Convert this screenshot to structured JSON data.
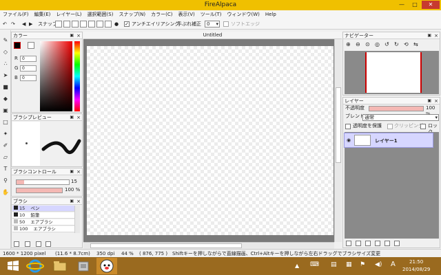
{
  "window": {
    "title": "FireAlpaca",
    "minimize_icon": "minimize-icon",
    "maximize_icon": "maximize-icon",
    "close_icon": "close-icon"
  },
  "menu": [
    "ファイル(F)",
    "編集(E)",
    "レイヤー(L)",
    "選択範囲(S)",
    "スナップ(N)",
    "カラー(C)",
    "表示(V)",
    "ツール(T)",
    "ウィンドウ(W)",
    "Help"
  ],
  "toolbar": {
    "snap_label": "スナップ",
    "antialias_label": "アンチエイリアシング",
    "antialias_checked": "✓",
    "stabilizer_label": "手ぶれ補正",
    "stabilizer_value": "0",
    "soft_edge_label": "ソフトエッジ"
  },
  "canvas": {
    "tab_title": "Untitled"
  },
  "color_panel": {
    "title": "カラー",
    "r_label": "R",
    "r_value": "0",
    "g_label": "G",
    "g_value": "0",
    "b_label": "B",
    "b_value": "0",
    "primary_color": "#000000"
  },
  "brush_preview": {
    "title": "ブラシプレビュー"
  },
  "brush_control": {
    "title": "ブラシコントロール",
    "size_value": "15",
    "opacity_value": "100 %",
    "size_fraction": 0.15,
    "opacity_fraction": 1.0
  },
  "brush_panel": {
    "title": "ブラシ",
    "items": [
      {
        "size": "15",
        "name": "ペン"
      },
      {
        "size": "10",
        "name": "鉛筆"
      },
      {
        "size": "50",
        "name": "エアブラシ"
      },
      {
        "size": "100",
        "name": "エアブラシ"
      }
    ]
  },
  "navigator": {
    "title": "ナビゲーター"
  },
  "layer_panel": {
    "title": "レイヤー",
    "opacity_label": "不透明度",
    "opacity_value": "100 %",
    "blend_label": "ブレンド",
    "blend_value": "通常",
    "protect_label": "透明度を保護",
    "clipping_label": "クリッピング",
    "lock_label": "ロック",
    "layers": [
      {
        "name": "レイヤー1"
      }
    ]
  },
  "status": {
    "size": "1600 * 1200 pixel",
    "cm": "(11.6 * 8.7cm)",
    "dpi": "350 dpi",
    "zoom": "44 %",
    "coords": "( 876, 775 )",
    "hint": "Shiftキーを押しながらで直線描画、Ctrl+Altキーを押しながら左右ドラッグでブラシサイズ変更"
  },
  "taskbar": {
    "time": "21:50",
    "date": "2014/08/29",
    "ime": "A"
  },
  "colors": {
    "titlebar": "#f0c000",
    "accent_pink": "#f4b8b4",
    "layer_selected": "#d6d6ff"
  }
}
